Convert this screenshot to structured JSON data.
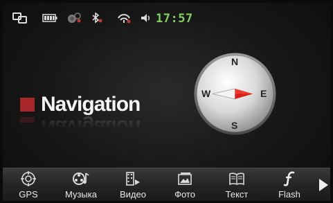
{
  "status_bar": {
    "time": "17:57",
    "icons": [
      "screen-sync-icon",
      "battery-icon",
      "gps-off-icon",
      "bluetooth-off-icon",
      "wifi-off-icon",
      "speaker-icon"
    ]
  },
  "main": {
    "title": "Navigation",
    "compass": {
      "north": "N",
      "south": "S",
      "east": "E",
      "west": "W"
    }
  },
  "bottom_bar": {
    "items": [
      {
        "label": "GPS",
        "icon": "gps-target-icon"
      },
      {
        "label": "Музыка",
        "icon": "music-icon"
      },
      {
        "label": "Видео",
        "icon": "video-icon"
      },
      {
        "label": "Фото",
        "icon": "photo-icon"
      },
      {
        "label": "Текст",
        "icon": "book-icon"
      },
      {
        "label": "Flash",
        "icon": "flash-icon"
      }
    ],
    "next_icon": "arrow-right-icon"
  },
  "colors": {
    "accent_red": "#a8262a",
    "clock_green": "#7ed35a",
    "needle_red": "#d9201b"
  }
}
